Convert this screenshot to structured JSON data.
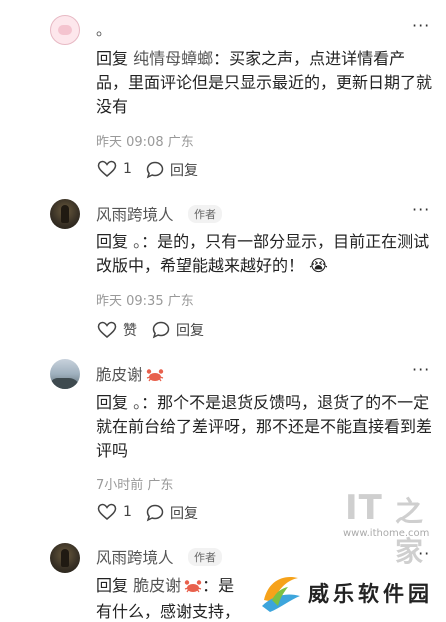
{
  "comments": [
    {
      "name": "。",
      "author_tag": "",
      "reply_prefix": "回复",
      "reply_to": "纯情母蟑螂",
      "text": "：买家之声，点进详情看产品，里面评论但是只显示最近的，更新日期了就没有",
      "time": "昨天 09:08",
      "location": "广东",
      "likes": "1",
      "reply_label": "回复"
    },
    {
      "name": "风雨跨境人",
      "author_tag": "作者",
      "reply_prefix": "回复",
      "reply_to": "。",
      "text": "：是的，只有一部分显示，目前正在测试改版中，希望能越来越好的！",
      "emoji": "😭",
      "time": "昨天 09:35",
      "location": "广东",
      "likes": "赞",
      "reply_label": "回复"
    },
    {
      "name": "脆皮谢",
      "author_tag": "",
      "reply_prefix": "回复",
      "reply_to": "。",
      "text": "：那个不是退货反馈吗，退货了的不一定就在前台给了差评呀，那不还是不能直接看到差评吗",
      "time": "7小时前",
      "location": "广东",
      "likes": "1",
      "reply_label": "回复"
    },
    {
      "name": "风雨跨境人",
      "author_tag": "作者",
      "reply_prefix": "回复",
      "reply_to": "脆皮谢",
      "text_line1": "：是",
      "text_line2": "有什么，感谢支持，"
    }
  ],
  "more_label": "···",
  "watermarks": {
    "ithome_logo": "IT",
    "ithome_zh": "之家",
    "ithome_url": "www.ithome.com",
    "site_name": "威乐软件园"
  },
  "icons": {
    "like": "heart-outline-icon",
    "reply": "speech-bubble-icon",
    "badge": "crab-icon"
  }
}
